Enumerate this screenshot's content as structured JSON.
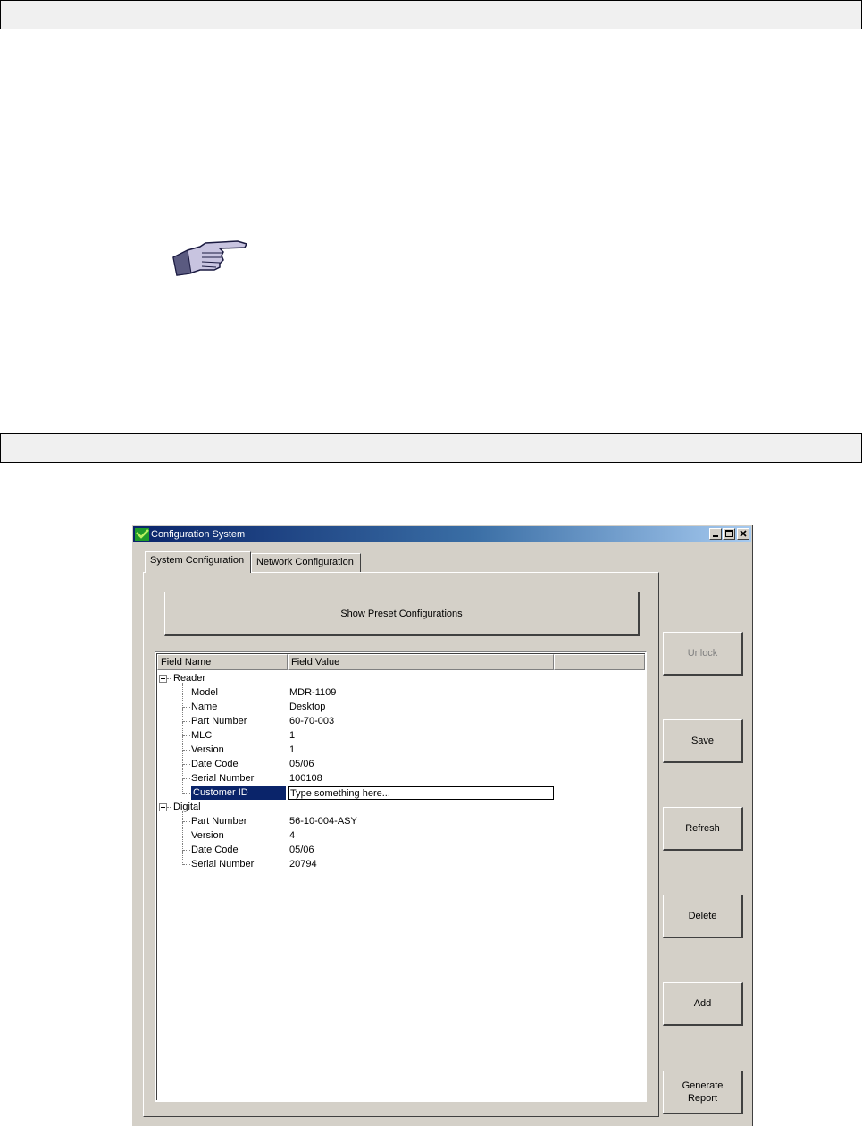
{
  "window": {
    "title": "Configuration System",
    "accent_color": "#0a246a"
  },
  "tabs": [
    {
      "label": "System Configuration",
      "active": true
    },
    {
      "label": "Network Configuration",
      "active": false
    }
  ],
  "buttons": {
    "show_preset": "Show Preset Configurations",
    "unlock": "Unlock",
    "save": "Save",
    "refresh": "Refresh",
    "delete": "Delete",
    "add": "Add",
    "generate_report": "Generate\nReport"
  },
  "list": {
    "columns": [
      "Field Name",
      "Field Value"
    ],
    "groups": [
      {
        "name": "Reader",
        "items": [
          {
            "field": "Model",
            "value": "MDR-1109"
          },
          {
            "field": "Name",
            "value": "Desktop"
          },
          {
            "field": "Part Number",
            "value": "60-70-003"
          },
          {
            "field": "MLC",
            "value": "1"
          },
          {
            "field": "Version",
            "value": "1"
          },
          {
            "field": "Date Code",
            "value": "05/06"
          },
          {
            "field": "Serial Number",
            "value": "100108"
          },
          {
            "field": "Customer ID",
            "value": "Type something here..."
          }
        ]
      },
      {
        "name": "Digital",
        "items": [
          {
            "field": "Part Number",
            "value": "56-10-004-ASY"
          },
          {
            "field": "Version",
            "value": "4"
          },
          {
            "field": "Date Code",
            "value": "05/06"
          },
          {
            "field": "Serial Number",
            "value": "20794"
          }
        ]
      }
    ]
  }
}
